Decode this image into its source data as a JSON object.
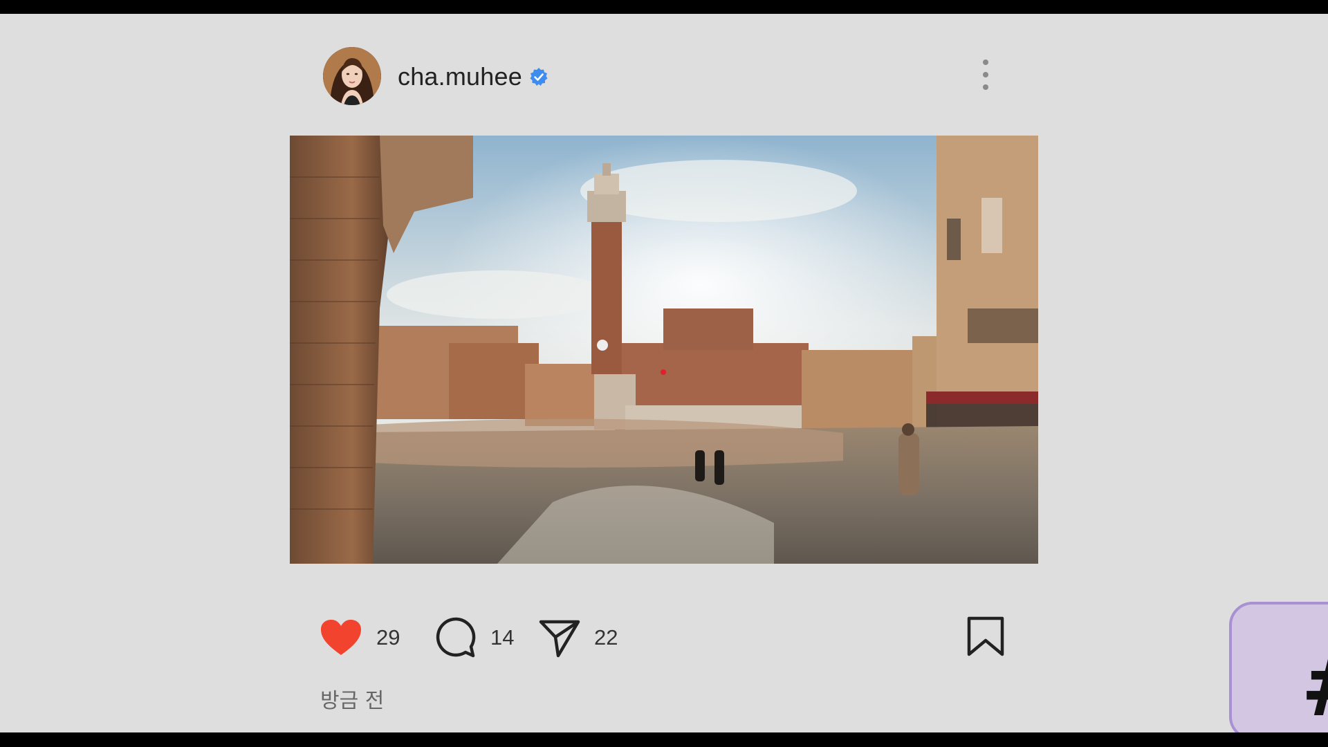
{
  "post": {
    "author": {
      "username": "cha.muhee",
      "avatar_icon": "profile-photo",
      "verified_icon": "verified-badge-icon",
      "verified_color": "#3d8cf0"
    },
    "menu_icon": "more-vertical-icon",
    "photo": {
      "icon": "photo-piazza-del-campo"
    },
    "actions": {
      "like_icon": "heart-icon",
      "like_count": "29",
      "like_color": "#f2432f",
      "comment_icon": "comment-icon",
      "comment_count": "14",
      "share_icon": "send-icon",
      "share_count": "22",
      "save_icon": "bookmark-icon"
    },
    "timestamp": "방금 전"
  },
  "corner_badge": {
    "glyph": "#",
    "color": "#d3c6e2"
  }
}
